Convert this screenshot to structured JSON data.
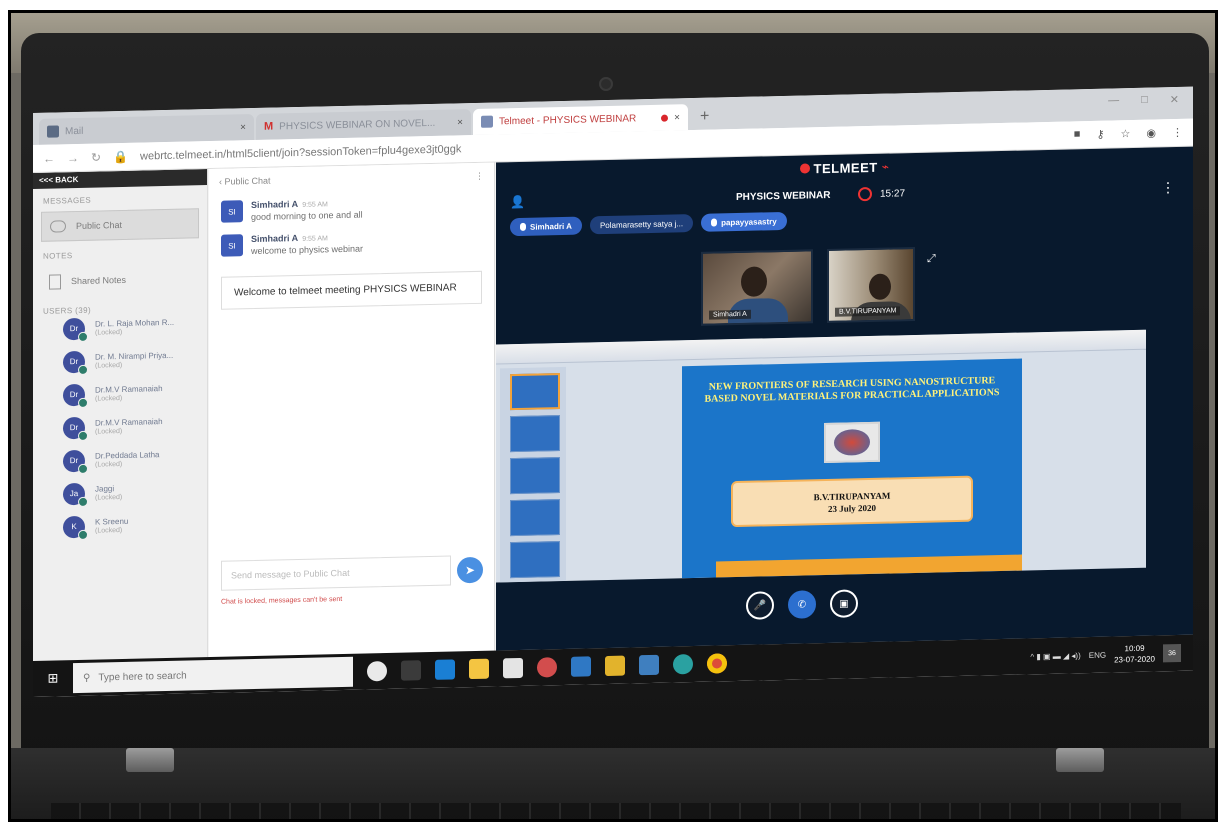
{
  "browser": {
    "tabs": [
      {
        "label": "Mail"
      },
      {
        "label": "PHYSICS WEBINAR ON NOVEL..."
      },
      {
        "label": "Telmeet - PHYSICS WEBINAR"
      }
    ],
    "url": "webrtc.telmeet.in/html5client/join?sessionToken=fplu4gexe3jt0ggk"
  },
  "app": {
    "back_label": "<<< BACK",
    "messages_title": "MESSAGES",
    "public_chat_label": "Public Chat",
    "notes_title": "NOTES",
    "shared_notes_label": "Shared Notes",
    "users_title": "USERS (39)",
    "users": [
      {
        "initials": "Dr",
        "name": "Dr. L. Raja Mohan R...",
        "status": "(Locked)"
      },
      {
        "initials": "Dr",
        "name": "Dr. M. Nirampi Priya...",
        "status": "(Locked)"
      },
      {
        "initials": "Dr",
        "name": "Dr.M.V Ramanaiah",
        "status": "(Locked)"
      },
      {
        "initials": "Dr",
        "name": "Dr.M.V Ramanaiah",
        "status": "(Locked)"
      },
      {
        "initials": "Dr",
        "name": "Dr.Peddada Latha",
        "status": "(Locked)"
      },
      {
        "initials": "Ja",
        "name": "Jaggi",
        "status": "(Locked)"
      },
      {
        "initials": "K",
        "name": "K Sreenu",
        "status": "(Locked)"
      }
    ]
  },
  "chat": {
    "header": "Public Chat",
    "messages": [
      {
        "initials": "SI",
        "sender": "Simhadri A",
        "time": "9:55 AM",
        "text": "good morning to one and all"
      },
      {
        "initials": "SI",
        "sender": "Simhadri A",
        "time": "9:55 AM",
        "text": "welcome to physics webinar"
      }
    ],
    "welcome": "Welcome to telmeet meeting PHYSICS WEBINAR",
    "input_placeholder": "Send message to Public Chat",
    "footer_note": "Chat is locked, messages can't be sent"
  },
  "stage": {
    "logo": "TELMEET",
    "meeting_title": "PHYSICS WEBINAR",
    "time": "15:27",
    "presenters": [
      "Simhadri A",
      "Polamarasetty satya j...",
      "papayyasastry"
    ],
    "cams": [
      {
        "label": "Simhadri A"
      },
      {
        "label": "B.V.TIRUPANYAM"
      }
    ],
    "slide": {
      "title": "NEW FRONTIERS OF RESEARCH USING NANOSTRUCTURE BASED NOVEL MATERIALS FOR PRACTICAL APPLICATIONS",
      "presenter": "B.V.TIRUPANYAM",
      "date": "23 July 2020"
    }
  },
  "taskbar": {
    "search_placeholder": "Type here to search",
    "lang": "ENG",
    "time": "10:09",
    "date": "23-07-2020",
    "notifications": "36"
  },
  "colors": {
    "stage_bg": "#08192d",
    "accent_blue": "#2f5fbe",
    "slide_blue": "#1b75c9",
    "record_red": "#e33"
  }
}
